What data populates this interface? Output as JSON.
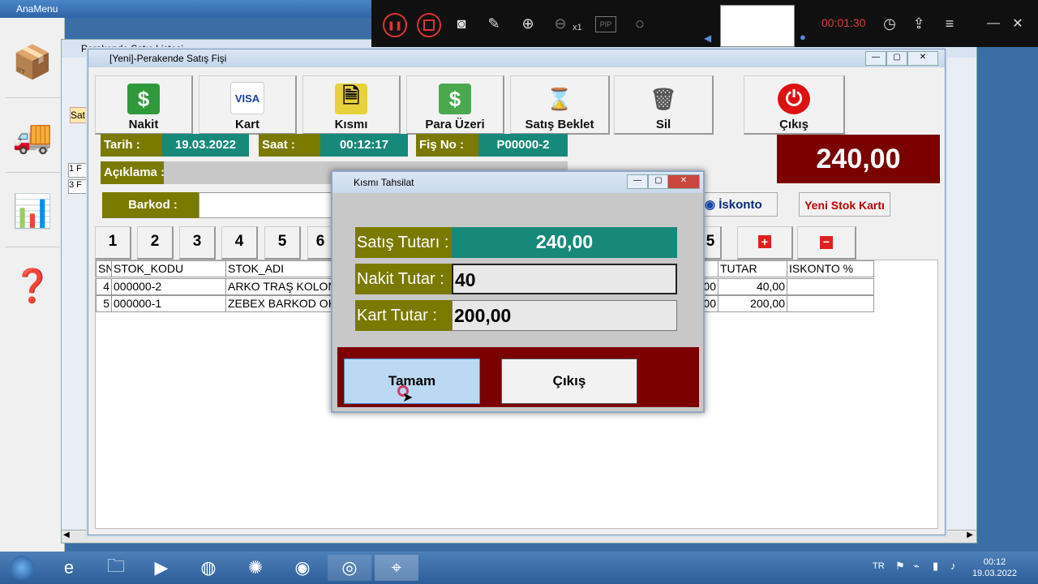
{
  "background_app": {
    "title": "AnaMenu",
    "back_window_title": "Perakende Satış Listesi",
    "back_tab": "Satı",
    "back_rows": [
      "1 F",
      "3 F"
    ]
  },
  "recorder": {
    "zoom_label": "x1",
    "pip_label": "PIP",
    "time": "00:01:30"
  },
  "main_window": {
    "title": "[Yeni]-Perakende Satış Fişi",
    "toolbar": [
      {
        "label": "Nakit",
        "icon": "cash-icon"
      },
      {
        "label": "Kart",
        "icon": "visa-card-icon"
      },
      {
        "label": "Kısmı",
        "icon": "documents-icon"
      },
      {
        "label": "Para Üzeri",
        "icon": "coins-icon"
      },
      {
        "label": "Satış Beklet",
        "icon": "hourglass-icon"
      },
      {
        "label": "Sil",
        "icon": "trash-icon"
      },
      {
        "label": "Çıkış",
        "icon": "power-icon"
      }
    ],
    "info": {
      "date_label": "Tarih :",
      "date_value": "19.03.2022",
      "time_label": "Saat :",
      "time_value": "00:12:17",
      "receipt_label": "Fiş No :",
      "receipt_value": "P00000-2",
      "note_label": "Açıklama :",
      "barcode_label": "Barkod :"
    },
    "total": "240,00",
    "discount_button": "İskonto",
    "new_stock_button": "Yeni Stok Kartı",
    "number_buttons": [
      "1",
      "2",
      "3",
      "4",
      "5",
      "6"
    ],
    "number_button_right": "5",
    "grid": {
      "headers": {
        "sn": "SN",
        "code": "STOK_KODU",
        "name": "STOK_ADI",
        "total": "TUTAR",
        "discount": "ISKONTO %"
      },
      "rows": [
        {
          "sn": "4",
          "code": "000000-2",
          "name": "ARKO TRAŞ KOLONY",
          "hidden_tail": "00",
          "total": "40,00",
          "discount": ""
        },
        {
          "sn": "5",
          "code": "000000-1",
          "name": "ZEBEX BARKOD OKU",
          "hidden_tail": "00",
          "total": "200,00",
          "discount": ""
        }
      ]
    }
  },
  "dialog": {
    "title": "Kısmı Tahsilat",
    "sale_total_label": "Satış Tutarı :",
    "sale_total_value": "240,00",
    "cash_label": "Nakit Tutar :",
    "cash_value": "40",
    "card_label": "Kart Tutar :",
    "card_value": "200,00",
    "ok_button": "Tamam",
    "exit_button": "Çıkış"
  },
  "taskbar": {
    "lang": "TR",
    "time": "00:12",
    "date": "19.03.2022"
  },
  "colors": {
    "olive": "#7a7a00",
    "teal": "#17897a",
    "maroon": "#7a0000"
  }
}
